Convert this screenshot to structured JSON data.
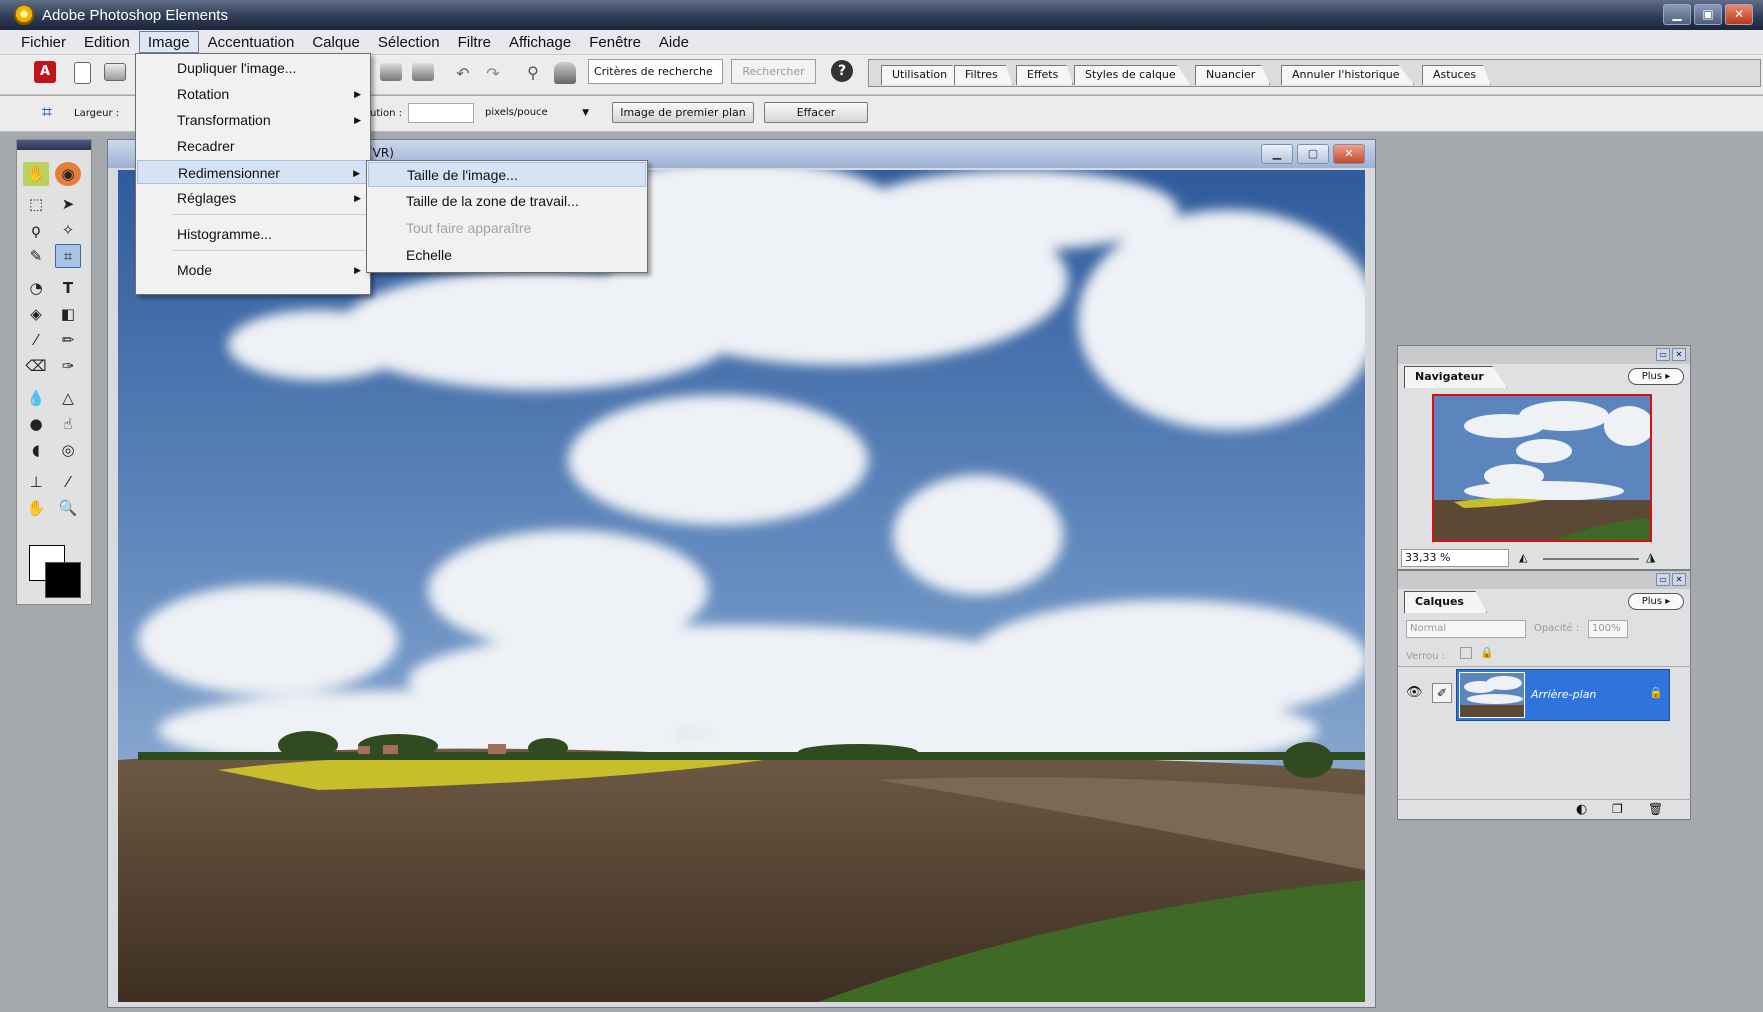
{
  "window": {
    "title": "Adobe Photoshop Elements"
  },
  "menubar": {
    "items": [
      "Fichier",
      "Edition",
      "Image",
      "Accentuation",
      "Calque",
      "Sélection",
      "Filtre",
      "Affichage",
      "Fenêtre",
      "Aide"
    ],
    "active": "Image"
  },
  "toolbar": {
    "search_placeholder": "Critères de recherche",
    "search_button": "Rechercher"
  },
  "palette_well": {
    "tabs": [
      "Utilisation",
      "Filtres",
      "Effets",
      "Styles de calque",
      "Nuancier",
      "Annuler l'historique",
      "Astuces"
    ]
  },
  "options_bar": {
    "width_label": "Largeur :",
    "resolution_label": "ution :",
    "units_value": "pixels/pouce",
    "front_image_button": "Image de premier plan",
    "clear_button": "Effacer"
  },
  "image_menu": {
    "items": [
      {
        "label": "Dupliquer l'image...",
        "submenu": false
      },
      {
        "label": "Rotation",
        "submenu": true
      },
      {
        "label": "Transformation",
        "submenu": true
      },
      {
        "label": "Recadrer",
        "submenu": false
      },
      {
        "label": "Redimensionner",
        "submenu": true
      },
      {
        "label": "Réglages",
        "submenu": true
      },
      {
        "label": "Histogramme...",
        "submenu": false
      },
      {
        "label": "Mode",
        "submenu": true
      }
    ],
    "highlighted": "Redimensionner"
  },
  "resize_submenu": {
    "items": [
      {
        "label": "Taille de l'image...",
        "enabled": true
      },
      {
        "label": "Taille de la zone de travail...",
        "enabled": true
      },
      {
        "label": "Tout faire apparaître",
        "enabled": false
      },
      {
        "label": "Echelle",
        "enabled": true
      }
    ],
    "highlighted": "Taille de l'image..."
  },
  "document": {
    "title_fragment": "(VR)"
  },
  "navigator_panel": {
    "tab_label": "Navigateur",
    "more_label": "Plus",
    "zoom_value": "33,33 %"
  },
  "layers_panel": {
    "tab_label": "Calques",
    "more_label": "Plus",
    "blend_mode": "Normal",
    "opacity_label": "Opacité :",
    "opacity_value": "100%",
    "lock_label": "Verrou :",
    "layers": [
      {
        "name": "Arrière-plan"
      }
    ]
  },
  "colors": {
    "selection_blue": "#2f74dc",
    "menu_highlight": "#d6e3f5",
    "title_bar": "#303d57"
  }
}
